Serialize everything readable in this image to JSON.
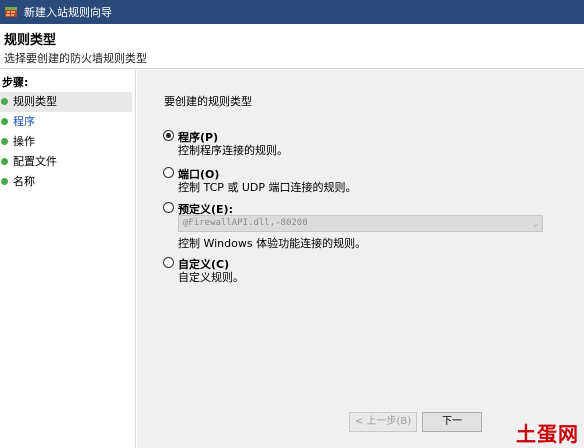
{
  "window": {
    "title": "新建入站规则向导"
  },
  "header": {
    "title": "规则类型",
    "subtitle": "选择要创建的防火墙规则类型"
  },
  "sidebar": {
    "steps_label": "步骤:",
    "items": [
      {
        "label": "规则类型",
        "state": "current"
      },
      {
        "label": "程序",
        "state": "link"
      },
      {
        "label": "操作",
        "state": "normal"
      },
      {
        "label": "配置文件",
        "state": "normal"
      },
      {
        "label": "名称",
        "state": "normal"
      }
    ]
  },
  "main": {
    "question": "要创建的规则类型",
    "options": [
      {
        "label": "程序(P)",
        "desc": "控制程序连接的规则。",
        "checked": true
      },
      {
        "label": "端口(O)",
        "desc": "控制 TCP 或 UDP 端口连接的规则。",
        "checked": false
      },
      {
        "label": "预定义(E):",
        "select_value": "@FirewallAPI.dll,-80200",
        "desc": "控制 Windows 体验功能连接的规则。",
        "checked": false
      },
      {
        "label": "自定义(C)",
        "desc": "自定义规则。",
        "checked": false
      }
    ]
  },
  "buttons": {
    "back": "< 上一步(B)",
    "next": "下一"
  },
  "watermark": {
    "text": "土蛋网"
  },
  "colors": {
    "titlebar": "#2a4a7a",
    "link": "#1a55b0",
    "step_dot": "#4aa84a",
    "panel_bg": "#f0f0f0"
  }
}
